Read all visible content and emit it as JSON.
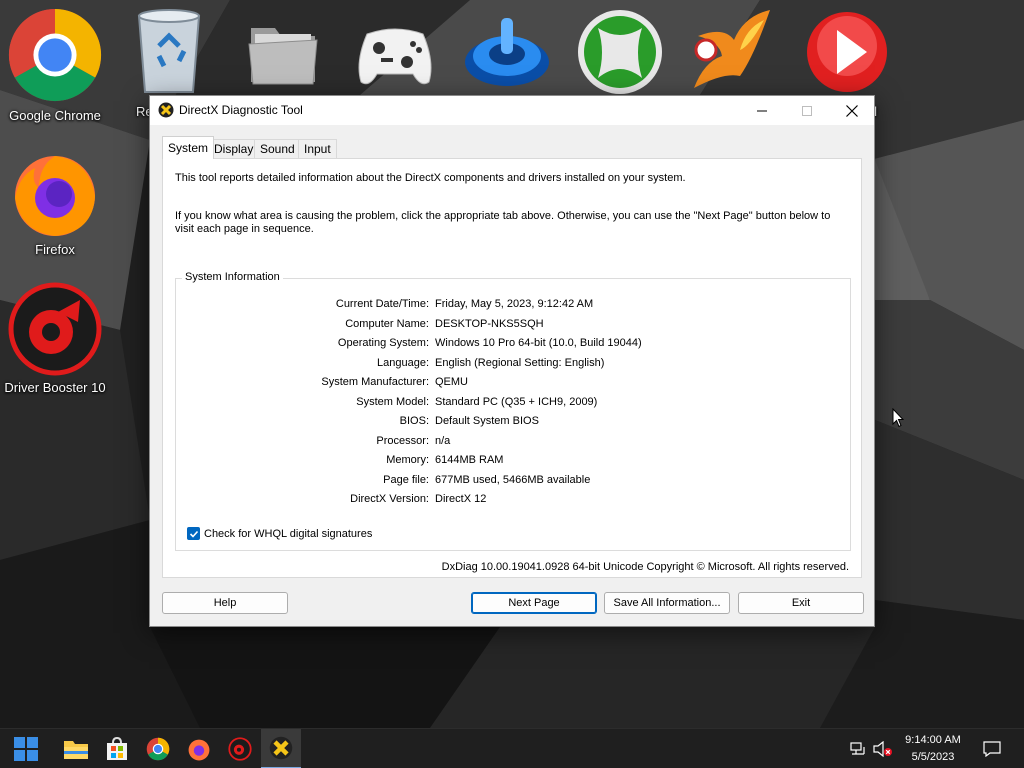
{
  "desktop": {
    "icons": [
      {
        "label": "Google Chrome",
        "icon": "chrome-icon"
      },
      {
        "label": "Re",
        "icon": "recycle-bin-icon"
      },
      {
        "label": "",
        "icon": "folder-icon"
      },
      {
        "label": "",
        "icon": "xbox-controller-icon"
      },
      {
        "label": "",
        "icon": "power-dial-icon"
      },
      {
        "label": "",
        "icon": "xbox-icon"
      },
      {
        "label": "",
        "icon": "phoenix-icon"
      },
      {
        "label": "el",
        "icon": "red-play-icon"
      },
      {
        "label": "Firefox",
        "icon": "firefox-icon"
      },
      {
        "label": "Driver Booster 10",
        "icon": "driver-booster-icon"
      }
    ]
  },
  "window": {
    "title": "DirectX Diagnostic Tool",
    "tabs": [
      {
        "label": "System",
        "active": true
      },
      {
        "label": "Display",
        "active": false
      },
      {
        "label": "Sound",
        "active": false
      },
      {
        "label": "Input",
        "active": false
      }
    ],
    "intro_line1": "This tool reports detailed information about the DirectX components and drivers installed on your system.",
    "intro_line2": "If you know what area is causing the problem, click the appropriate tab above.  Otherwise, you can use the \"Next Page\" button below to visit each page in sequence.",
    "system_info": {
      "legend": "System Information",
      "rows": [
        {
          "label": "Current Date/Time:",
          "value": "Friday, May 5, 2023, 9:12:42 AM"
        },
        {
          "label": "Computer Name:",
          "value": "DESKTOP-NKS5SQH"
        },
        {
          "label": "Operating System:",
          "value": "Windows 10 Pro 64-bit (10.0, Build 19044)"
        },
        {
          "label": "Language:",
          "value": "English (Regional Setting: English)"
        },
        {
          "label": "System Manufacturer:",
          "value": "QEMU"
        },
        {
          "label": "System Model:",
          "value": "Standard PC (Q35 + ICH9, 2009)"
        },
        {
          "label": "BIOS:",
          "value": "Default System BIOS"
        },
        {
          "label": "Processor:",
          "value": "n/a"
        },
        {
          "label": "Memory:",
          "value": "6144MB RAM"
        },
        {
          "label": "Page file:",
          "value": "677MB used, 5466MB available"
        },
        {
          "label": "DirectX Version:",
          "value": "DirectX 12"
        }
      ],
      "whql_label": "Check for WHQL digital signatures",
      "whql_checked": true
    },
    "copyright": "DxDiag 10.00.19041.0928 64-bit Unicode  Copyright © Microsoft. All rights reserved.",
    "buttons": {
      "help": "Help",
      "next_page": "Next Page",
      "save_all": "Save All Information...",
      "exit": "Exit"
    }
  },
  "taskbar": {
    "items": [
      "start-icon",
      "file-explorer-icon",
      "store-icon",
      "chrome-icon",
      "firefox-icon",
      "driver-booster-icon",
      "directx-icon"
    ],
    "active_item": "directx-icon",
    "clock_time": "9:14:00 AM",
    "clock_date": "5/5/2023"
  },
  "colors": {
    "accent": "#0067c0",
    "taskbar": "#1f1f1f",
    "window_bg": "#f0f0f0"
  }
}
